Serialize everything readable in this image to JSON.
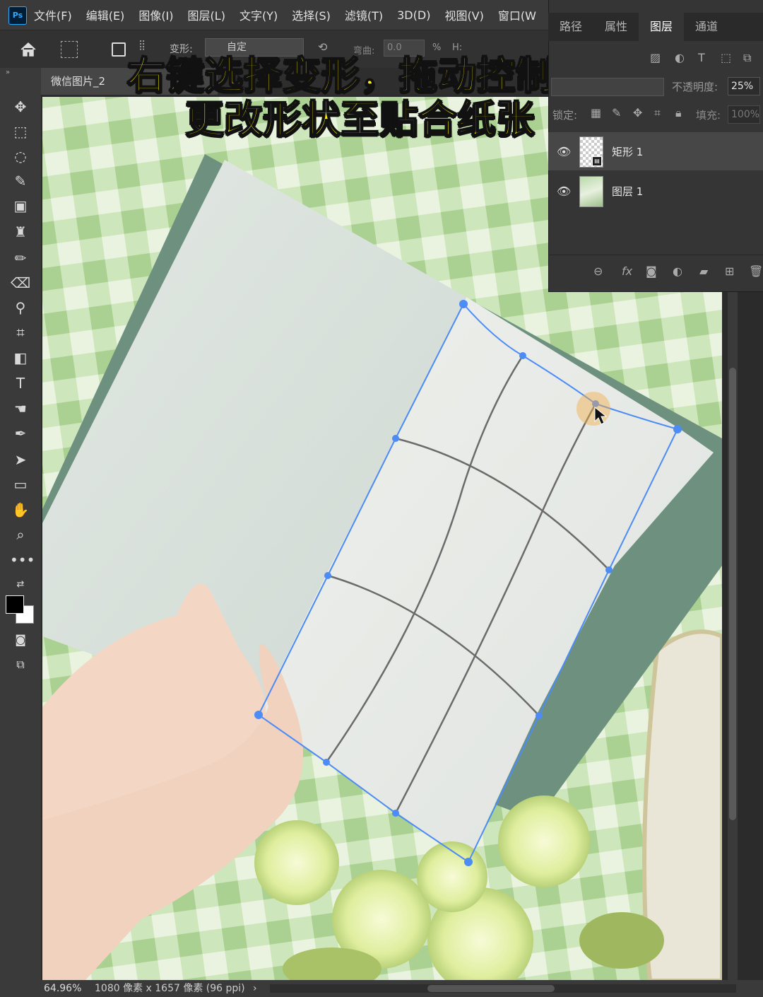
{
  "app": {
    "logo": "Ps",
    "menu": [
      "文件(F)",
      "编辑(E)",
      "图像(I)",
      "图层(L)",
      "文字(Y)",
      "选择(S)",
      "滤镜(T)",
      "3D(D)",
      "视图(V)",
      "窗口(W"
    ]
  },
  "options_bar": {
    "mode_label": "变形:",
    "mode_value": "自定",
    "bend_label": "弯曲:",
    "bend_value": "0.0",
    "percent": "%",
    "h_label": "H:"
  },
  "document": {
    "tab_title": "微信图片_2",
    "zoom": "64.96%",
    "info": "1080 像素 x 1657 像素 (96 ppi)",
    "status_arrow": "›"
  },
  "caption": {
    "line1": "右键选择变形，拖动控制柄",
    "line2": "更改形状至贴合纸张"
  },
  "layers_panel": {
    "tabs": [
      "路径",
      "属性",
      "图层",
      "通道"
    ],
    "active_tab": "图层",
    "opacity_label": "不透明度:",
    "opacity_value": "25%",
    "lock_label": "锁定:",
    "fill_label": "填充:",
    "fill_value": "100%",
    "layers": [
      {
        "name": "矩形 1",
        "selected": true,
        "thumb": "transparent-smart-object"
      },
      {
        "name": "图层 1",
        "selected": false,
        "thumb": "photo"
      }
    ]
  },
  "icons": {
    "tools": [
      "move-icon",
      "marquee-icon",
      "lasso-icon",
      "quick-select-icon",
      "crop-frame-icon",
      "stamp-icon",
      "brush-icon",
      "eraser-icon",
      "eyedropper-icon",
      "crop-icon",
      "gradient-icon",
      "type-icon",
      "smudge-icon",
      "pen-icon",
      "path-select-icon",
      "rectangle-icon",
      "hand-icon",
      "zoom-icon",
      "more-icon"
    ]
  },
  "colors": {
    "accent": "#4d8bf5",
    "caption_fill": "#fff200",
    "ui_dark": "#353535"
  }
}
